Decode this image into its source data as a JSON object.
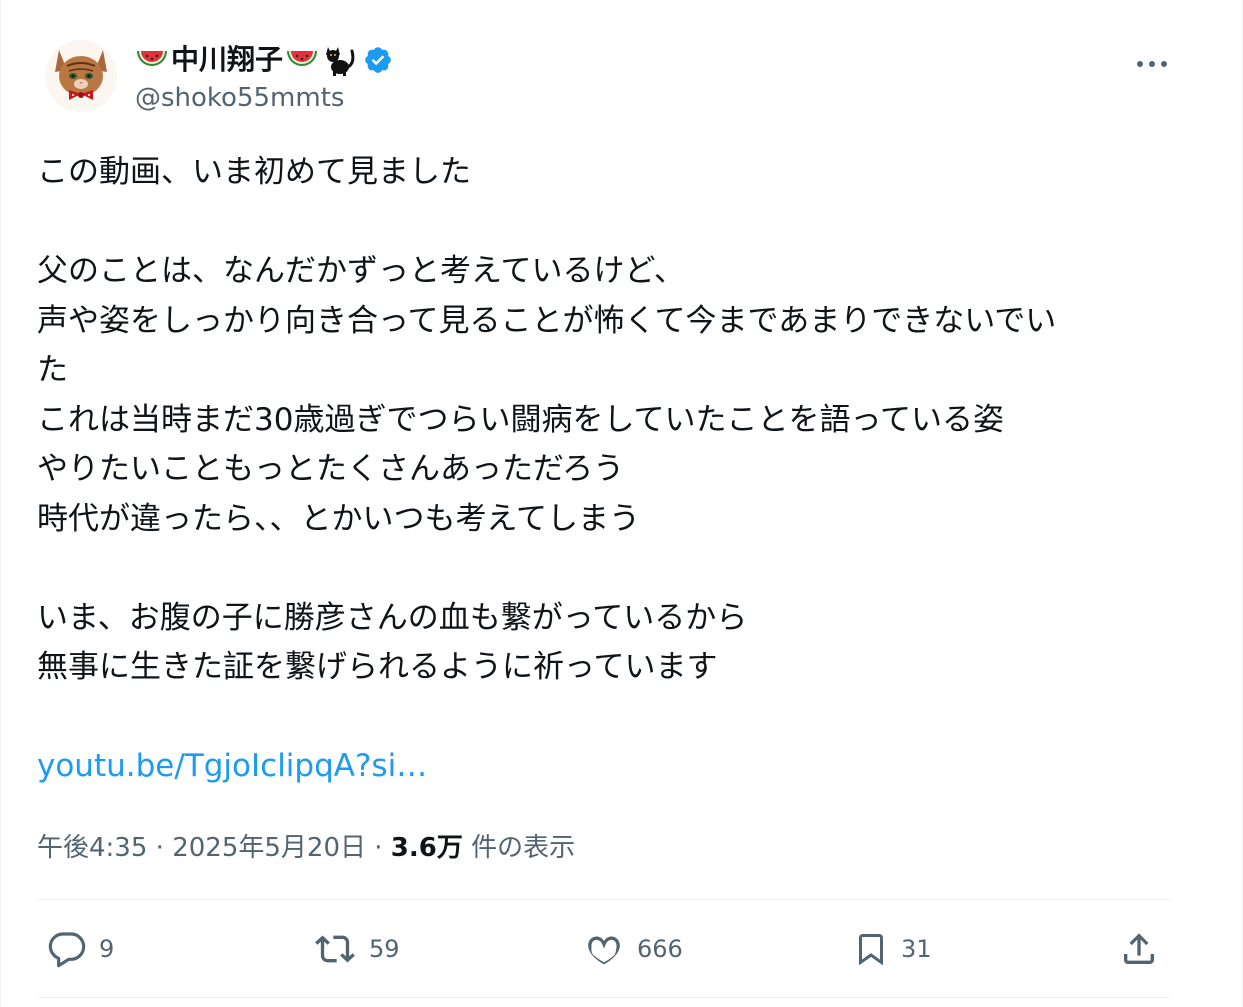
{
  "author": {
    "display_name": "中川翔子",
    "handle": "@shoko55mmts",
    "name_emojis": [
      "watermelon-icon",
      "watermelon-icon",
      "black-cat-icon"
    ],
    "verified": true
  },
  "tweet": {
    "lines": [
      "この動画、いま初めて見ました",
      "",
      "父のことは、なんだかずっと考えているけど、",
      "声や姿をしっかり向き合って見ることが怖くて今まであまりできないでい",
      "た",
      "これは当時まだ30歳過ぎでつらい闘病をしていたことを語っている姿",
      "やりたいこともっとたくさんあっただろう",
      "時代が違ったら、、とかいつも考えてしまう",
      "",
      "いま、お腹の子に勝彦さんの血も繋がっているから",
      "無事に生きた証を繋げられるように祈っています",
      ""
    ],
    "link": "youtu.be/TgjoIclipqA?si…"
  },
  "meta": {
    "time": "午後4:35",
    "separator1": " · ",
    "date": "2025年5月20日",
    "separator2": " · ",
    "views_count": "3.6万",
    "views_label": " 件の表示"
  },
  "actions": {
    "replies": "9",
    "reposts": "59",
    "likes": "666",
    "bookmarks": "31"
  },
  "colors": {
    "link": "#1d9bf0",
    "secondary_text": "#536471",
    "primary_text": "#0f1419",
    "verified": "#1d9bf0",
    "divider": "#eff3f4"
  }
}
